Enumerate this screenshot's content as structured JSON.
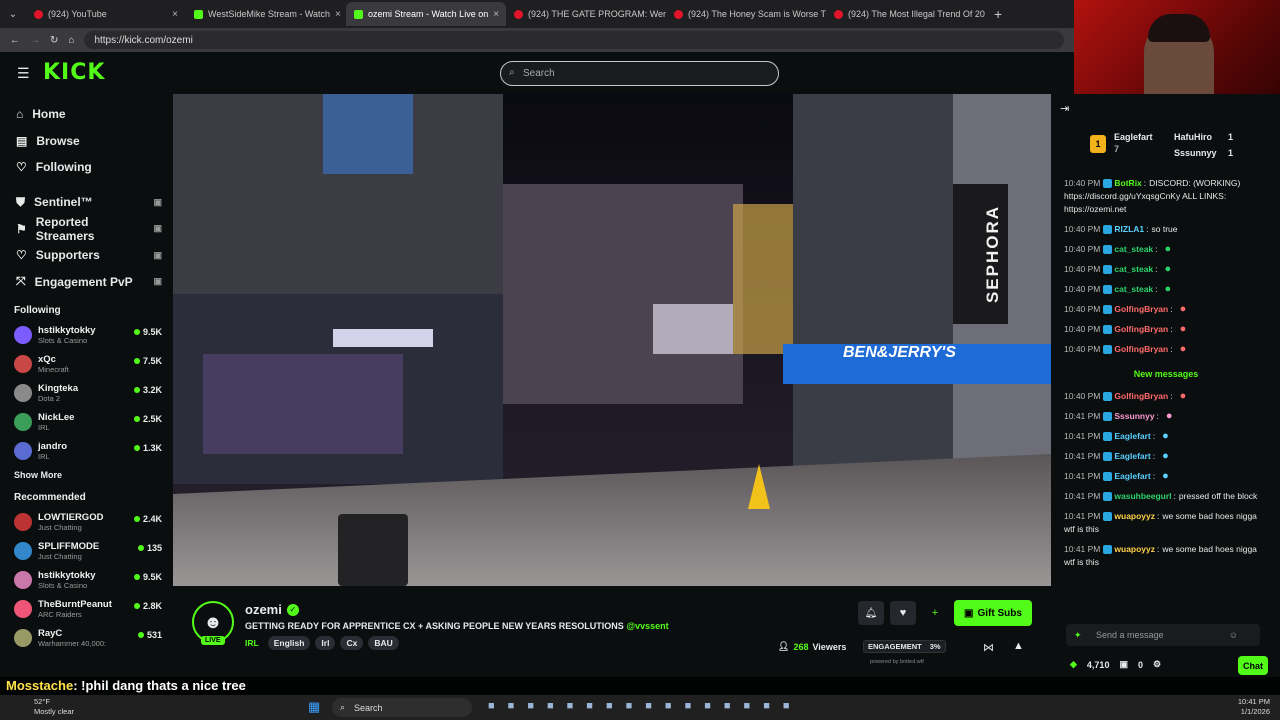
{
  "browser": {
    "tabs": [
      {
        "title": "(924) YouTube",
        "active": false,
        "kind": "youtube"
      },
      {
        "title": "WestSideMike Stream - Watch",
        "active": false,
        "kind": "kick"
      },
      {
        "title": "ozemi Stream - Watch Live on",
        "active": true,
        "kind": "kick"
      },
      {
        "title": "(924) THE GATE PROGRAM: Were",
        "active": false,
        "kind": "youtube"
      },
      {
        "title": "(924) The Honey Scam is Worse Th",
        "active": false,
        "kind": "youtube"
      },
      {
        "title": "(924) The Most Illegal Trend Of 20",
        "active": false,
        "kind": "youtube"
      }
    ],
    "url": "https://kick.com/ozemi"
  },
  "header": {
    "logo": "KICK",
    "search_placeholder": "Search"
  },
  "sidebar": {
    "nav": [
      {
        "label": "Home",
        "icon": "home-icon"
      },
      {
        "label": "Browse",
        "icon": "browse-icon"
      },
      {
        "label": "Following",
        "icon": "heart-icon"
      }
    ],
    "nav2": [
      {
        "label": "Sentinel™",
        "icon": "shield-icon"
      },
      {
        "label": "Reported Streamers",
        "icon": "flag-icon"
      },
      {
        "label": "Supporters",
        "icon": "heart-icon"
      },
      {
        "label": "Engagement PvP",
        "icon": "engagement-icon"
      }
    ],
    "following_title": "Following",
    "following": [
      {
        "name": "hstikkytokky",
        "category": "Slots & Casino",
        "viewers": "9.5K"
      },
      {
        "name": "xQc",
        "category": "Minecraft",
        "viewers": "7.5K"
      },
      {
        "name": "Kingteka",
        "category": "Dota 2",
        "viewers": "3.2K"
      },
      {
        "name": "NickLee",
        "category": "IRL",
        "viewers": "2.5K"
      },
      {
        "name": "jandro",
        "category": "IRL",
        "viewers": "1.3K"
      }
    ],
    "show_more": "Show More",
    "recommended_title": "Recommended",
    "recommended": [
      {
        "name": "LOWTIERGOD",
        "category": "Just Chatting",
        "viewers": "2.4K"
      },
      {
        "name": "SPLIFFMODE",
        "category": "Just Chatting",
        "viewers": "135"
      },
      {
        "name": "hstikkytokky",
        "category": "Slots & Casino",
        "viewers": "9.5K"
      },
      {
        "name": "TheBurntPeanut",
        "category": "ARC Raiders",
        "viewers": "2.8K"
      },
      {
        "name": "RayC",
        "category": "Warhammer 40,000:",
        "viewers": "531"
      }
    ]
  },
  "stream": {
    "channel": "ozemi",
    "live": "LIVE",
    "title": "GETTING READY FOR APPRENTICE CX + ASKING PEOPLE  NEW YEARS RESOLUTIONS",
    "mention": "@vvssent",
    "category": "IRL",
    "tags": [
      "English",
      "Irl",
      "Cx",
      "BAU"
    ],
    "viewers": "268",
    "viewers_label": "Viewers",
    "engagement_label": "ENGAGEMENT",
    "engagement_value": "3%",
    "powered_by": "powered by botted.wtf",
    "gift_subs": "Gift Subs",
    "signage": [
      "SEPHORA",
      "BEN&JERRY'S"
    ]
  },
  "chat": {
    "top_gifters": [
      {
        "rank": "1",
        "name": "Eaglefart",
        "count": "7"
      },
      {
        "name": "HafuHiro",
        "count": "1"
      },
      {
        "name": "Sssunnyy",
        "count": "1"
      }
    ],
    "messages": [
      {
        "time": "10:40 PM",
        "user": "BotRix",
        "color": "#53fc18",
        "text": "DISCORD: (WORKING) https://discord.gg/uYxqsgCnKy ALL LINKS: https://ozemi.net"
      },
      {
        "time": "10:40 PM",
        "user": "RIZLA1",
        "color": "#5ad1ff",
        "text": "so true"
      },
      {
        "time": "10:40 PM",
        "user": "cat_steak",
        "color": "#2bd46b",
        "text": ""
      },
      {
        "time": "10:40 PM",
        "user": "cat_steak",
        "color": "#2bd46b",
        "text": ""
      },
      {
        "time": "10:40 PM",
        "user": "cat_steak",
        "color": "#2bd46b",
        "text": ""
      },
      {
        "time": "10:40 PM",
        "user": "GolfingBryan",
        "color": "#ff6a6a",
        "text": ""
      },
      {
        "time": "10:40 PM",
        "user": "GolfingBryan",
        "color": "#ff6a6a",
        "text": ""
      },
      {
        "time": "10:40 PM",
        "user": "GolfingBryan",
        "color": "#ff6a6a",
        "text": ""
      }
    ],
    "new_messages": "New messages",
    "messages2": [
      {
        "time": "10:40 PM",
        "user": "GolfingBryan",
        "color": "#ff6a6a",
        "text": ""
      },
      {
        "time": "10:41 PM",
        "user": "Sssunnyy",
        "color": "#ff9bd2",
        "text": ""
      },
      {
        "time": "10:41 PM",
        "user": "Eaglefart",
        "color": "#5ad1ff",
        "text": ""
      },
      {
        "time": "10:41 PM",
        "user": "Eaglefart",
        "color": "#5ad1ff",
        "text": ""
      },
      {
        "time": "10:41 PM",
        "user": "Eaglefart",
        "color": "#5ad1ff",
        "text": ""
      },
      {
        "time": "10:41 PM",
        "user": "wasuhbeegurl",
        "color": "#2bd46b",
        "text": "pressed off the block"
      },
      {
        "time": "10:41 PM",
        "user": "wuapoyyz",
        "color": "#ffd24a",
        "text": "we some bad hoes nigga wtf is this"
      },
      {
        "time": "10:41 PM",
        "user": "wuapoyyz",
        "color": "#ffd24a",
        "text": "we some bad hoes nigga wtf is this"
      }
    ],
    "input_placeholder": "Send a message",
    "points": "4,710",
    "gift_count": "0",
    "chat_button": "Chat"
  },
  "caption": {
    "user": "Mosstache",
    "text": ": !phil dang thats a nice tree"
  },
  "taskbar": {
    "weather_temp": "52°F",
    "weather_desc": "Mostly clear",
    "search": "Search",
    "time": "10:41 PM",
    "date": "1/1/2026"
  },
  "colors": {
    "kick_green": "#53fc18",
    "bg": "#0b0e0f"
  }
}
